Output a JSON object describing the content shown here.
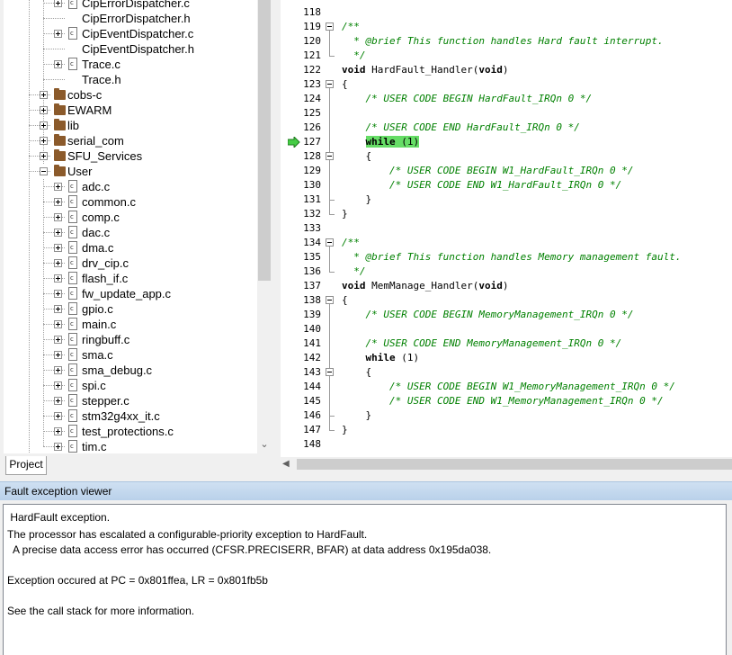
{
  "project_tree": {
    "tab_label": "Project",
    "rows": [
      {
        "label": "CipErrorDispatcher.c",
        "level": 3,
        "type": "file-c",
        "expander": "plus"
      },
      {
        "label": "CipErrorDispatcher.h",
        "level": 3,
        "type": "file-h",
        "expander": "none"
      },
      {
        "label": "CipEventDispatcher.c",
        "level": 3,
        "type": "file-c",
        "expander": "plus"
      },
      {
        "label": "CipEventDispatcher.h",
        "level": 3,
        "type": "file-h",
        "expander": "none"
      },
      {
        "label": "Trace.c",
        "level": 3,
        "type": "file-c",
        "expander": "plus"
      },
      {
        "label": "Trace.h",
        "level": 3,
        "type": "file-h",
        "expander": "none"
      },
      {
        "label": "cobs-c",
        "level": 2,
        "type": "folder",
        "expander": "plus"
      },
      {
        "label": "EWARM",
        "level": 2,
        "type": "folder",
        "expander": "plus"
      },
      {
        "label": "lib",
        "level": 2,
        "type": "folder",
        "expander": "plus"
      },
      {
        "label": "serial_com",
        "level": 2,
        "type": "folder",
        "expander": "plus"
      },
      {
        "label": "SFU_Services",
        "level": 2,
        "type": "folder",
        "expander": "plus"
      },
      {
        "label": "User",
        "level": 2,
        "type": "folder",
        "expander": "minus"
      },
      {
        "label": "adc.c",
        "level": 3,
        "type": "file-c",
        "expander": "plus"
      },
      {
        "label": "common.c",
        "level": 3,
        "type": "file-c",
        "expander": "plus"
      },
      {
        "label": "comp.c",
        "level": 3,
        "type": "file-c",
        "expander": "plus"
      },
      {
        "label": "dac.c",
        "level": 3,
        "type": "file-c",
        "expander": "plus"
      },
      {
        "label": "dma.c",
        "level": 3,
        "type": "file-c",
        "expander": "plus"
      },
      {
        "label": "drv_cip.c",
        "level": 3,
        "type": "file-c",
        "expander": "plus"
      },
      {
        "label": "flash_if.c",
        "level": 3,
        "type": "file-c",
        "expander": "plus"
      },
      {
        "label": "fw_update_app.c",
        "level": 3,
        "type": "file-c",
        "expander": "plus"
      },
      {
        "label": "gpio.c",
        "level": 3,
        "type": "file-c",
        "expander": "plus"
      },
      {
        "label": "main.c",
        "level": 3,
        "type": "file-c",
        "expander": "plus"
      },
      {
        "label": "ringbuff.c",
        "level": 3,
        "type": "file-c",
        "expander": "plus"
      },
      {
        "label": "sma.c",
        "level": 3,
        "type": "file-c",
        "expander": "plus"
      },
      {
        "label": "sma_debug.c",
        "level": 3,
        "type": "file-c",
        "expander": "plus"
      },
      {
        "label": "spi.c",
        "level": 3,
        "type": "file-c",
        "expander": "plus"
      },
      {
        "label": "stepper.c",
        "level": 3,
        "type": "file-c",
        "expander": "plus"
      },
      {
        "label": "stm32g4xx_it.c",
        "level": 3,
        "type": "file-c",
        "expander": "plus"
      },
      {
        "label": "test_protections.c",
        "level": 3,
        "type": "file-c",
        "expander": "plus"
      },
      {
        "label": "tim.c",
        "level": 3,
        "type": "file-c",
        "expander": "plus"
      }
    ]
  },
  "editor": {
    "current_line": 127,
    "lines": [
      {
        "num": "118",
        "segments": []
      },
      {
        "num": "119",
        "segments": [
          {
            "t": "/**",
            "c": "comment"
          }
        ]
      },
      {
        "num": "120",
        "segments": [
          {
            "t": "  * @brief This function handles Hard fault interrupt.",
            "c": "comment"
          }
        ]
      },
      {
        "num": "121",
        "segments": [
          {
            "t": "  */",
            "c": "comment"
          }
        ]
      },
      {
        "num": "122",
        "segments": [
          {
            "t": "void",
            "c": "kw"
          },
          {
            "t": " HardFault_Handler(",
            "c": ""
          },
          {
            "t": "void",
            "c": "kw"
          },
          {
            "t": ")",
            "c": ""
          }
        ]
      },
      {
        "num": "123",
        "segments": [
          {
            "t": "{",
            "c": ""
          }
        ]
      },
      {
        "num": "124",
        "segments": [
          {
            "t": "    ",
            "c": ""
          },
          {
            "t": "/* USER CODE BEGIN HardFault_IRQn 0 */",
            "c": "comment"
          }
        ]
      },
      {
        "num": "125",
        "segments": []
      },
      {
        "num": "126",
        "segments": [
          {
            "t": "    ",
            "c": ""
          },
          {
            "t": "/* USER CODE END HardFault_IRQn 0 */",
            "c": "comment"
          }
        ]
      },
      {
        "num": "127",
        "segments": [
          {
            "t": "    ",
            "c": ""
          },
          {
            "t": "while",
            "c": "kw-hl"
          },
          {
            "t": " (1)",
            "c": "hl"
          }
        ]
      },
      {
        "num": "128",
        "segments": [
          {
            "t": "    {",
            "c": ""
          }
        ]
      },
      {
        "num": "129",
        "segments": [
          {
            "t": "        ",
            "c": ""
          },
          {
            "t": "/* USER CODE BEGIN W1_HardFault_IRQn 0 */",
            "c": "comment"
          }
        ]
      },
      {
        "num": "130",
        "segments": [
          {
            "t": "        ",
            "c": ""
          },
          {
            "t": "/* USER CODE END W1_HardFault_IRQn 0 */",
            "c": "comment"
          }
        ]
      },
      {
        "num": "131",
        "segments": [
          {
            "t": "    }",
            "c": ""
          }
        ]
      },
      {
        "num": "132",
        "segments": [
          {
            "t": "}",
            "c": ""
          }
        ]
      },
      {
        "num": "133",
        "segments": []
      },
      {
        "num": "134",
        "segments": [
          {
            "t": "/**",
            "c": "comment"
          }
        ]
      },
      {
        "num": "135",
        "segments": [
          {
            "t": "  * @brief This function handles Memory management fault.",
            "c": "comment"
          }
        ]
      },
      {
        "num": "136",
        "segments": [
          {
            "t": "  */",
            "c": "comment"
          }
        ]
      },
      {
        "num": "137",
        "segments": [
          {
            "t": "void",
            "c": "kw"
          },
          {
            "t": " MemManage_Handler(",
            "c": ""
          },
          {
            "t": "void",
            "c": "kw"
          },
          {
            "t": ")",
            "c": ""
          }
        ]
      },
      {
        "num": "138",
        "segments": [
          {
            "t": "{",
            "c": ""
          }
        ]
      },
      {
        "num": "139",
        "segments": [
          {
            "t": "    ",
            "c": ""
          },
          {
            "t": "/* USER CODE BEGIN MemoryManagement_IRQn 0 */",
            "c": "comment"
          }
        ]
      },
      {
        "num": "140",
        "segments": []
      },
      {
        "num": "141",
        "segments": [
          {
            "t": "    ",
            "c": ""
          },
          {
            "t": "/* USER CODE END MemoryManagement_IRQn 0 */",
            "c": "comment"
          }
        ]
      },
      {
        "num": "142",
        "segments": [
          {
            "t": "    ",
            "c": ""
          },
          {
            "t": "while",
            "c": "kw"
          },
          {
            "t": " (1)",
            "c": ""
          }
        ]
      },
      {
        "num": "143",
        "segments": [
          {
            "t": "    {",
            "c": ""
          }
        ]
      },
      {
        "num": "144",
        "segments": [
          {
            "t": "        ",
            "c": ""
          },
          {
            "t": "/* USER CODE BEGIN W1_MemoryManagement_IRQn 0 */",
            "c": "comment"
          }
        ]
      },
      {
        "num": "145",
        "segments": [
          {
            "t": "        ",
            "c": ""
          },
          {
            "t": "/* USER CODE END W1_MemoryManagement_IRQn 0 */",
            "c": "comment"
          }
        ]
      },
      {
        "num": "146",
        "segments": [
          {
            "t": "    }",
            "c": ""
          }
        ]
      },
      {
        "num": "147",
        "segments": [
          {
            "t": "}",
            "c": ""
          }
        ]
      },
      {
        "num": "148",
        "segments": []
      }
    ]
  },
  "fault_viewer": {
    "title": "Fault exception viewer",
    "lines": [
      " HardFault exception.",
      "The processor has escalated a configurable-priority exception to HardFault.",
      "  A precise data access error has occurred (CFSR.PRECISERR, BFAR) at data address 0x195da038.",
      "",
      "Exception occured at PC = 0x801ffea, LR = 0x801fb5b",
      "",
      "See the call stack for more information."
    ]
  },
  "colors": {
    "comment": "#008000",
    "highlight": "#66dd66",
    "folder": "#8b5a2b",
    "title_bar": "#b9d1ea"
  }
}
